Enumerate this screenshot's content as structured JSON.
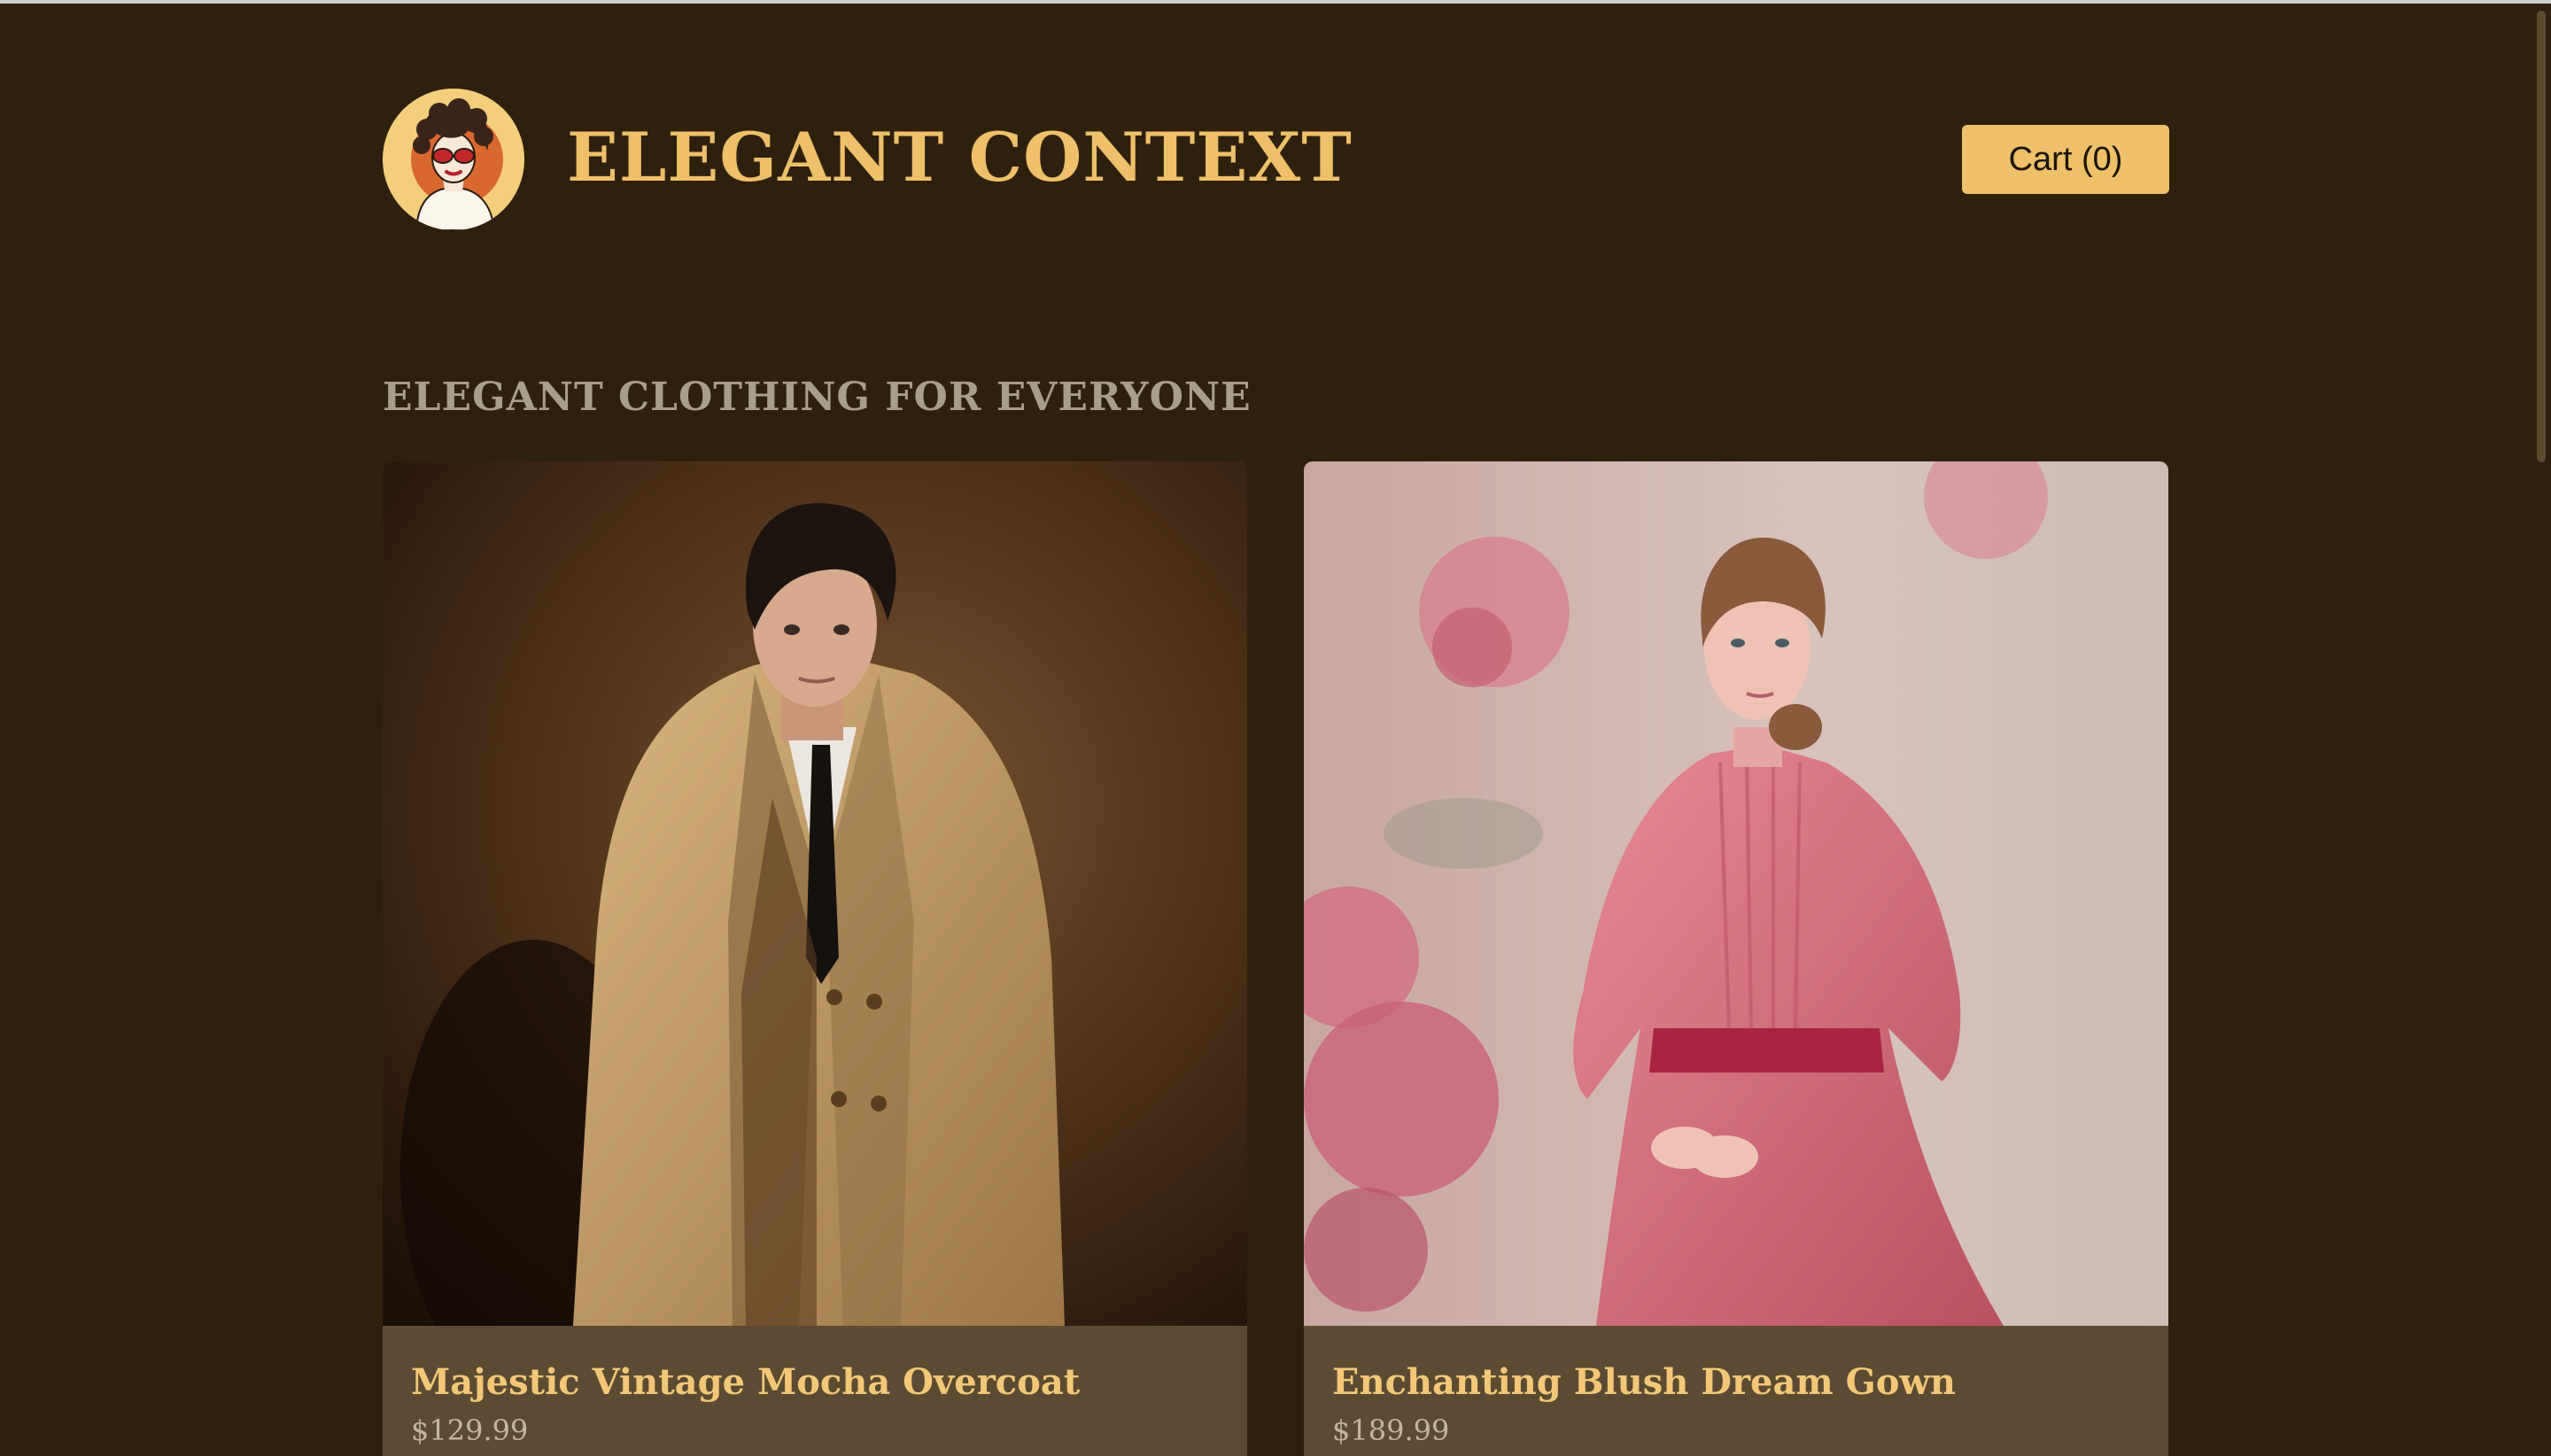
{
  "header": {
    "site_title": "ELEGANT CONTEXT",
    "logo_icon": "vintage-woman-sunglasses-logo",
    "cart_label": "Cart (0)"
  },
  "main": {
    "section_heading": "ELEGANT CLOTHING FOR EVERYONE",
    "products": [
      {
        "name": "Majestic Vintage Mocha Overcoat",
        "price": "$129.99",
        "image": "man-in-beige-trench-coat-photo"
      },
      {
        "name": "Enchanting Blush Dream Gown",
        "price": "$189.99",
        "image": "woman-in-pink-dress-photo"
      }
    ]
  },
  "colors": {
    "page_background": "#2f200e",
    "accent_gold": "#edc069",
    "card_background": "#5d4a33",
    "heading_muted": "#a99d8b",
    "price_text": "#c5b59c"
  }
}
